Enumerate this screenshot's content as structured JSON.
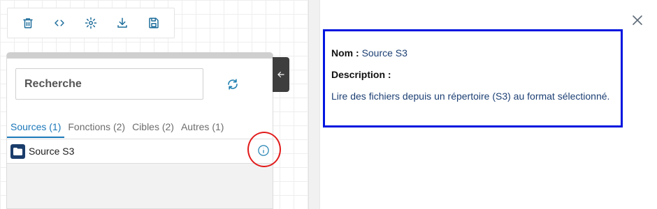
{
  "toolbar": {
    "items": [
      {
        "name": "delete",
        "icon": "trash-icon"
      },
      {
        "name": "code",
        "icon": "code-icon"
      },
      {
        "name": "settings",
        "icon": "gear-icon"
      },
      {
        "name": "download",
        "icon": "download-icon"
      },
      {
        "name": "save",
        "icon": "save-icon"
      }
    ]
  },
  "palette": {
    "search": {
      "placeholder": "Recherche"
    },
    "tabs": [
      {
        "label": "Sources (1)",
        "active": true
      },
      {
        "label": "Fonctions (2)",
        "active": false
      },
      {
        "label": "Cibles (2)",
        "active": false
      },
      {
        "label": "Autres (1)",
        "active": false
      }
    ],
    "items": [
      {
        "label": "Source S3",
        "icon": "folder-icon"
      }
    ]
  },
  "details": {
    "name_label": "Nom :",
    "name_value": "Source S3",
    "description_label": "Description :",
    "description_value": "Lire des fichiers depuis un répertoire (S3) au format sélectionné."
  },
  "colors": {
    "accent": "#1a77b8",
    "highlight_ring": "#e21b1b",
    "details_border": "#0016e0",
    "folder_icon_bg": "#1a3d6b"
  }
}
